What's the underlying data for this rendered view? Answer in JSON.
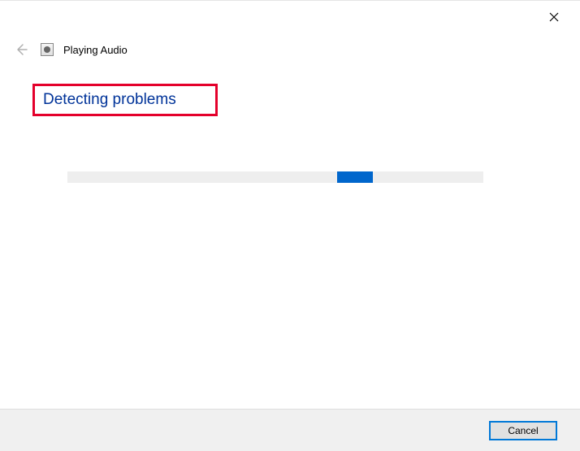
{
  "header": {
    "title": "Playing Audio"
  },
  "status": {
    "heading": "Detecting problems"
  },
  "footer": {
    "cancel_label": "Cancel"
  }
}
